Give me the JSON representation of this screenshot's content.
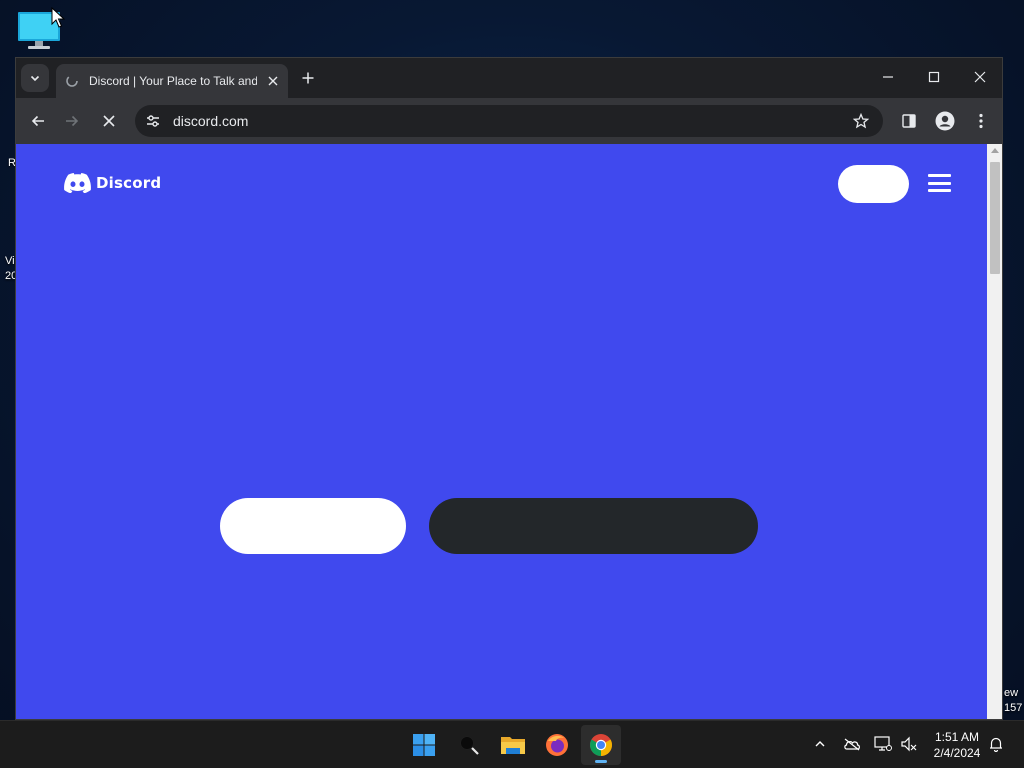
{
  "desktop": {
    "fragments": [
      "R",
      "Vi",
      "20",
      "ew",
      "157"
    ]
  },
  "browser": {
    "tab": {
      "title": "Discord | Your Place to Talk and Hang Out",
      "favicon": "loading-icon"
    },
    "controls": {
      "tab_search": "chevron-down-icon",
      "new_tab": "plus-icon",
      "minimize": "minimize-icon",
      "maximize": "maximize-icon",
      "close": "close-icon"
    },
    "toolbar": {
      "back": "back-arrow-icon",
      "forward": "forward-arrow-icon",
      "stop": "stop-icon",
      "site_info": "tune-icon",
      "url": "discord.com",
      "bookmark": "star-icon",
      "side_panel": "side-panel-icon",
      "profile": "profile-icon",
      "menu": "kebab-menu-icon"
    }
  },
  "page": {
    "logo_text": "Discord",
    "background_color": "#4049ee",
    "dark_button_color": "#23272a"
  },
  "taskbar": {
    "apps": [
      "windows-start-icon",
      "search-icon",
      "file-explorer-icon",
      "firefox-icon",
      "chrome-icon"
    ],
    "active_app": "chrome",
    "time": "1:51 AM",
    "date": "2/4/2024"
  }
}
